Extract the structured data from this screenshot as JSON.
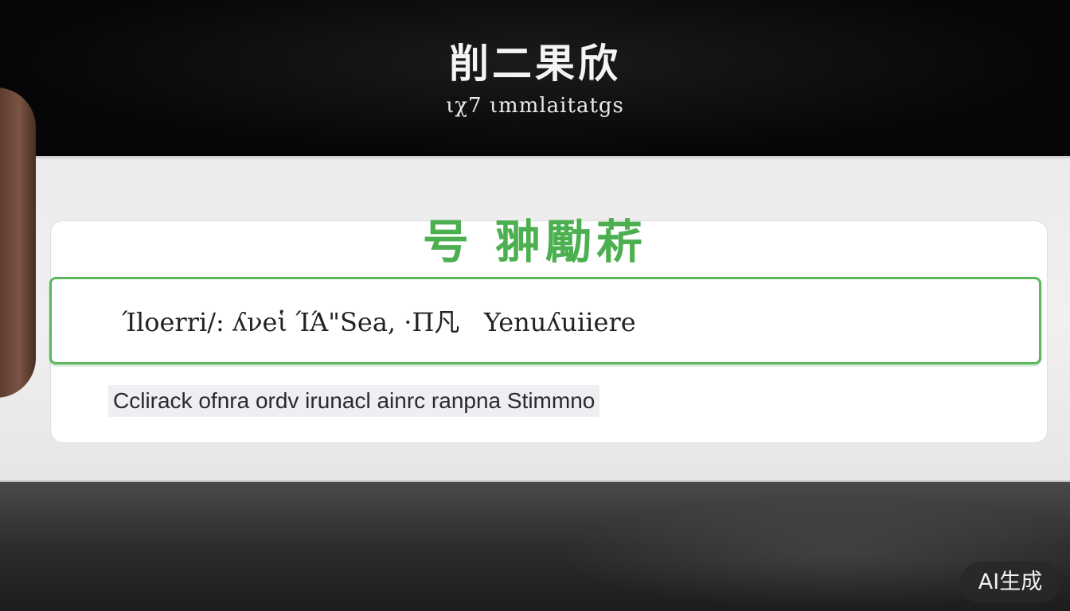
{
  "header": {
    "title": "削二果欣",
    "subtitle": "ιχ7 ιmmlaitatgs"
  },
  "card": {
    "heading": "号 翀勵菥",
    "search_value": "Ίloerri/: ʎνeἱ ΊΆ\"Sea, ·Π凡   Yenuʎuiiere",
    "caption": "Cclirack  ofnra ordv irunacl  ainrc ranpna   Stimmno"
  },
  "watermark": {
    "label": "AI生成"
  },
  "colors": {
    "accent_green": "#4caf50",
    "header_background": "#0a0a0a",
    "panel_background": "#efefef"
  }
}
